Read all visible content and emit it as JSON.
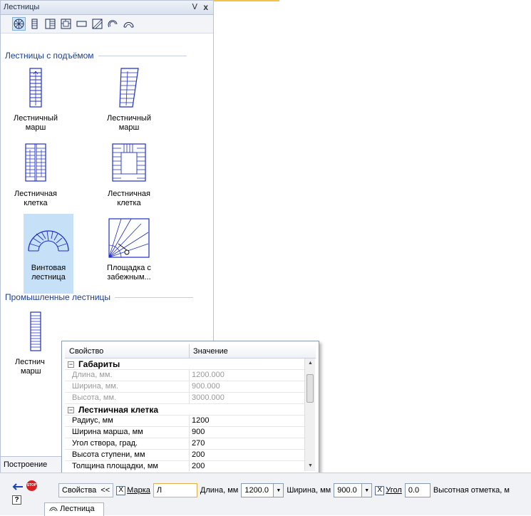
{
  "panel": {
    "title": "Лестницы",
    "pin_icon": "pin-icon",
    "close_symbol": "x"
  },
  "toolbar": {
    "icons": [
      "spiral-stair-icon",
      "straight-stair-icon",
      "stair-landing-icon",
      "stair-cell-icon",
      "rectangle-icon",
      "slanted-square-icon",
      "spiral-arrow-icon",
      "arc-icon"
    ]
  },
  "sections": {
    "lifting": "Лестницы с подъёмом",
    "industrial": "Промышленные лестницы"
  },
  "tiles": {
    "t1": "Лестничный марш",
    "t2": "Лестничный марш",
    "t3": "Лестничная клетка",
    "t4": "Лестничная клетка",
    "t5": "Винтовая лестница",
    "t6": "Площадка с забежным...",
    "t7_top": "Лестнич",
    "t7_bottom": "марш"
  },
  "bottom_tab": {
    "label": "Построение"
  },
  "grid": {
    "col_property": "Свойство",
    "col_value": "Значение",
    "group1": "Габариты",
    "group2": "Лестничная клетка",
    "rows": [
      {
        "name": "Длина, мм.",
        "value": "1200.000"
      },
      {
        "name": "Ширина, мм.",
        "value": "900.000"
      },
      {
        "name": "Высота, мм.",
        "value": "3000.000"
      },
      {
        "name": "Радиус, мм",
        "value": "1200"
      },
      {
        "name": "Ширина марша, мм",
        "value": "900"
      },
      {
        "name": "Угол створа, град.",
        "value": "270"
      },
      {
        "name": "Высота ступени, мм",
        "value": "200"
      },
      {
        "name": "Толщина площадки, мм",
        "value": "200"
      }
    ]
  },
  "propbar": {
    "props_button": "Свойства",
    "collapse": "<<",
    "marka_label": "Марка",
    "marka_value": "Л",
    "length_label": "Длина, мм",
    "length_value": "1200.0",
    "width_label": "Ширина, мм",
    "width_value": "900.0",
    "angle_label": "Угол",
    "angle_value": "0.0",
    "height_label": "Высотная отметка, м",
    "stop_text": "STOP",
    "help_text": "?",
    "check_mark": "X",
    "doc_tab": "Лестница"
  },
  "colors": {
    "accent": "#1c3f94",
    "selection": "#c6e0f7",
    "stair_blue": "#1f2fc8"
  }
}
